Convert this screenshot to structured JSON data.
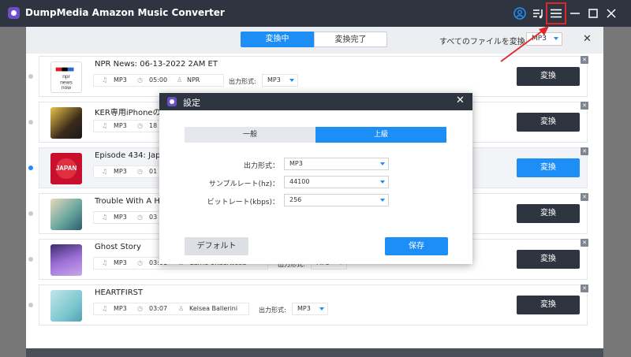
{
  "app": {
    "title": "DumpMedia Amazon Music Converter"
  },
  "header": {
    "tab_converting": "変換中",
    "tab_done": "変換完了",
    "convert_all_label": "すべてのファイルを変換:",
    "convert_all_format": "MP3"
  },
  "songs": [
    {
      "title": "NPR News: 06-13-2022 2AM ET",
      "format": "MP3",
      "duration": "05:00",
      "artist": "NPR",
      "output_label": "出力形式:",
      "output_format": "MP3",
      "button": "変換",
      "selected": false
    },
    {
      "title": "KER専用iPhoneのク",
      "format": "MP3",
      "duration": "18",
      "artist": "",
      "output_label": "",
      "output_format": "",
      "button": "変換",
      "selected": false
    },
    {
      "title": "Episode 434: Japan",
      "format": "MP3",
      "duration": "01",
      "artist": "",
      "output_label": "",
      "output_format": "",
      "button": "変換",
      "selected": true
    },
    {
      "title": "Trouble With A Hea",
      "format": "MP3",
      "duration": "03",
      "artist": "",
      "output_label": "",
      "output_format": "",
      "button": "変換",
      "selected": false
    },
    {
      "title": "Ghost Story",
      "format": "MP3",
      "duration": "03:01",
      "artist": "Carrie Underwood",
      "output_label": "出力形式:",
      "output_format": "MP3",
      "button": "変換",
      "selected": false
    },
    {
      "title": "HEARTFIRST",
      "format": "MP3",
      "duration": "03:07",
      "artist": "Kelsea Ballerini",
      "output_label": "出力形式:",
      "output_format": "MP3",
      "button": "変換",
      "selected": false
    }
  ],
  "dialog": {
    "title": "設定",
    "tab_general": "一般",
    "tab_advanced": "上級",
    "fields": [
      {
        "label": "出力形式：",
        "value": "MP3"
      },
      {
        "label": "サンプルレート(hz)：",
        "value": "44100"
      },
      {
        "label": "ビットレート(kbps)：",
        "value": "256"
      }
    ],
    "default_button": "デフォルト",
    "save_button": "保存"
  },
  "colors": {
    "accent": "#1e8ef7",
    "titlebar": "#2f3540",
    "annotation": "#e0262b"
  }
}
